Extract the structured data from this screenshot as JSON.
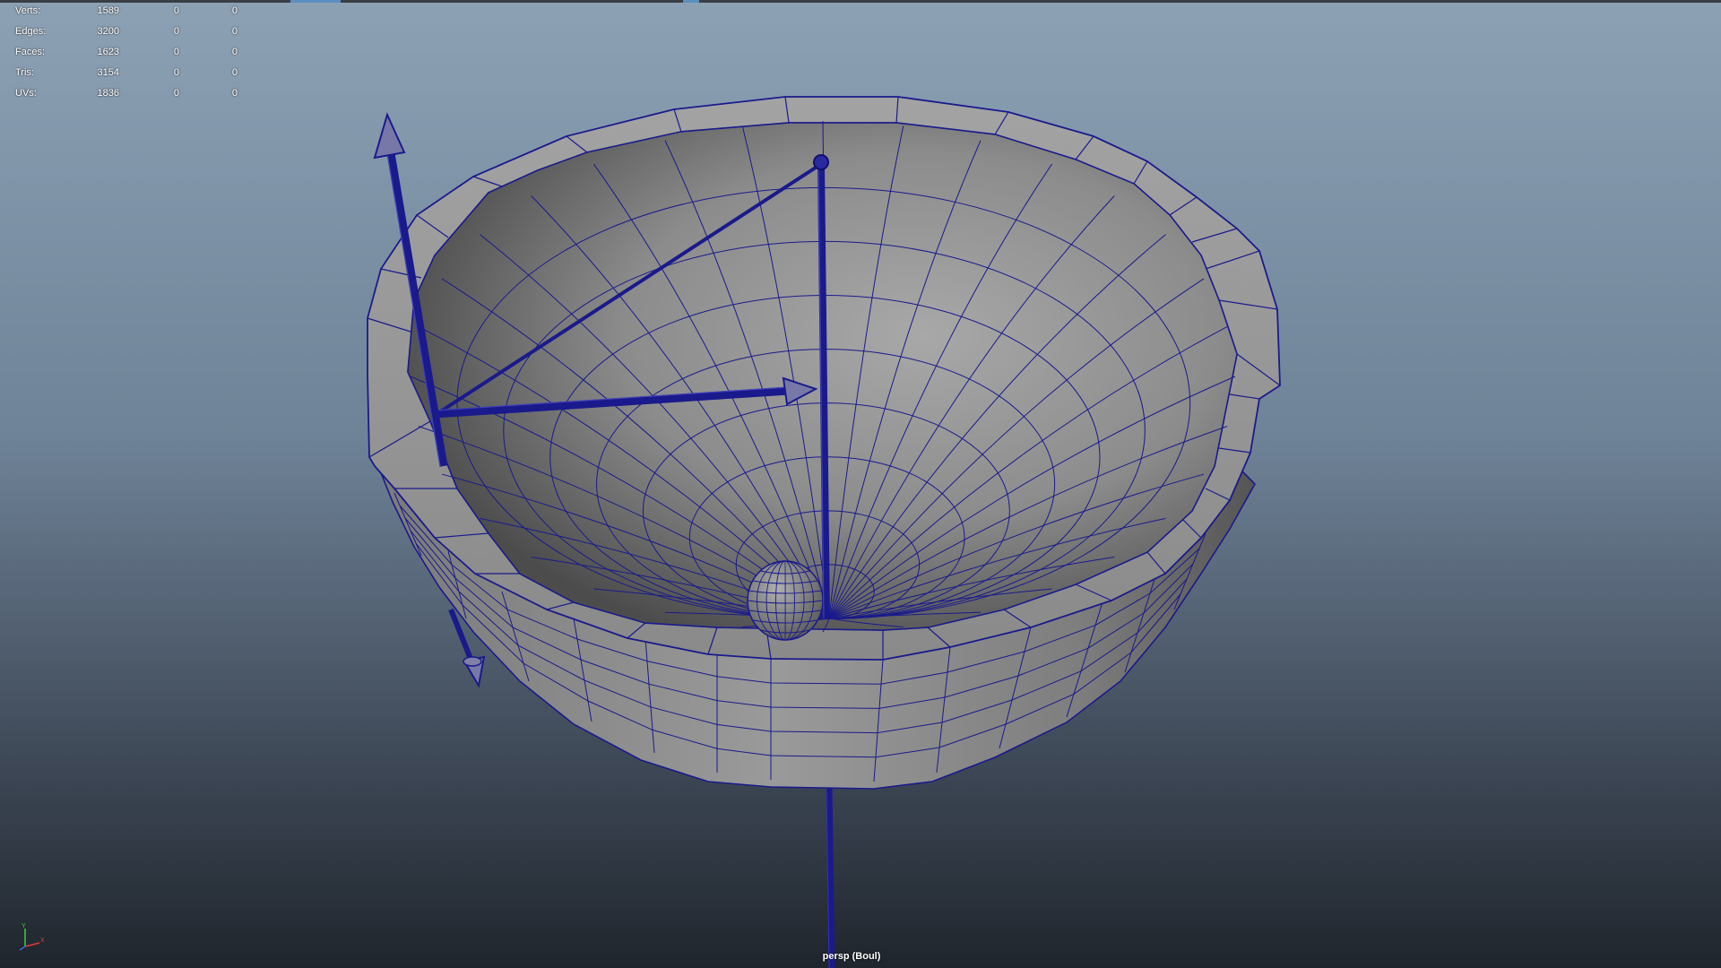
{
  "hud": {
    "rows": [
      {
        "label": "Verts:",
        "values": [
          "1589",
          "0",
          "0"
        ]
      },
      {
        "label": "Edges:",
        "values": [
          "3200",
          "0",
          "0"
        ]
      },
      {
        "label": "Faces:",
        "values": [
          "1623",
          "0",
          "0"
        ]
      },
      {
        "label": "Tris:",
        "values": [
          "3154",
          "0",
          "0"
        ]
      },
      {
        "label": "UVs:",
        "values": [
          "1836",
          "0",
          "0"
        ]
      }
    ]
  },
  "viewport": {
    "camera_label": "persp (Boul)",
    "axis_labels": {
      "y": "Y",
      "x": "X"
    }
  },
  "colors": {
    "wire": "#1a1a8c",
    "mesh_light": "#9a9a9a",
    "mesh_dark": "#4a4a4a",
    "bg_top": "#8da1b5",
    "bg_bottom": "#1f252c"
  },
  "icons": [
    "axis-indicator-icon"
  ]
}
